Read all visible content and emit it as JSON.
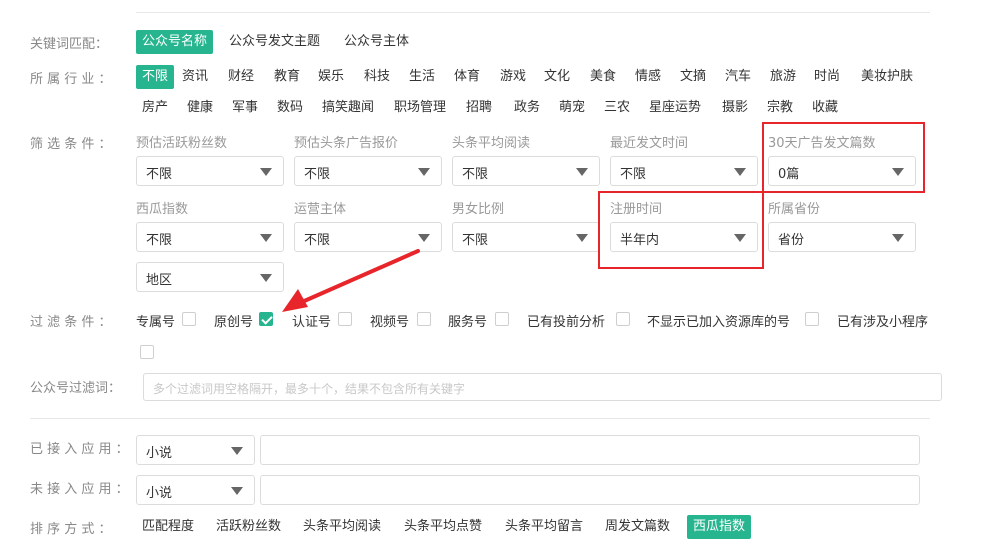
{
  "rows": {
    "keyword": {
      "label": "关键词匹配：",
      "options": [
        "公众号名称",
        "公众号发文主题",
        "公众号主体"
      ],
      "active": 0
    },
    "industry": {
      "label": "所 属 行 业 ：",
      "row1": [
        "不限",
        "资讯",
        "财经",
        "教育",
        "娱乐",
        "科技",
        "生活",
        "体育",
        "游戏",
        "文化",
        "美食",
        "情感",
        "文摘",
        "汽车",
        "旅游",
        "时尚",
        "美妆护肤"
      ],
      "row2": [
        "房产",
        "健康",
        "军事",
        "数码",
        "搞笑趣闻",
        "职场管理",
        "招聘",
        "政务",
        "萌宠",
        "三农",
        "星座运势",
        "摄影",
        "宗教",
        "收藏"
      ]
    },
    "filter": {
      "label": "筛 选 条 件 ：",
      "fields": [
        {
          "label": "预估活跃粉丝数",
          "value": "不限"
        },
        {
          "label": "预估头条广告报价",
          "value": "不限"
        },
        {
          "label": "头条平均阅读",
          "value": "不限"
        },
        {
          "label": "最近发文时间",
          "value": "不限"
        },
        {
          "label": "30天广告发文篇数",
          "value": "0篇"
        },
        {
          "label": "西瓜指数",
          "value": "不限"
        },
        {
          "label": "运营主体",
          "value": "不限"
        },
        {
          "label": "男女比例",
          "value": "不限"
        },
        {
          "label": "注册时间",
          "value": "半年内"
        },
        {
          "label": "所属省份",
          "value": "省份"
        },
        {
          "label": "",
          "value": "地区"
        }
      ]
    },
    "checks": {
      "label": "过 滤 条 件 ：",
      "items": [
        {
          "label": "专属号",
          "checked": false
        },
        {
          "label": "原创号",
          "checked": true
        },
        {
          "label": "认证号",
          "checked": false
        },
        {
          "label": "视频号",
          "checked": false
        },
        {
          "label": "服务号",
          "checked": false
        },
        {
          "label": "已有投前分析",
          "checked": false
        },
        {
          "label": "不显示已加入资源库的号",
          "checked": false
        },
        {
          "label": "已有涉及小程序",
          "checked": false
        }
      ]
    },
    "exclude": {
      "label": "公众号过滤词：",
      "placeholder": "多个过滤词用空格隔开，最多十个，结果不包含所有关键字"
    },
    "connected": {
      "label": "已 接 入 应 用 ：",
      "value": "小说"
    },
    "not_connected": {
      "label": "未 接 入 应 用 ：",
      "value": "小说"
    },
    "sort": {
      "label": "排 序 方 式 ：",
      "options": [
        "匹配程度",
        "活跃粉丝数",
        "头条平均阅读",
        "头条平均点赞",
        "头条平均留言",
        "周发文篇数",
        "西瓜指数"
      ],
      "active": 6
    }
  },
  "colors": {
    "accent": "#26b58f",
    "highlight": "#e8252a"
  }
}
